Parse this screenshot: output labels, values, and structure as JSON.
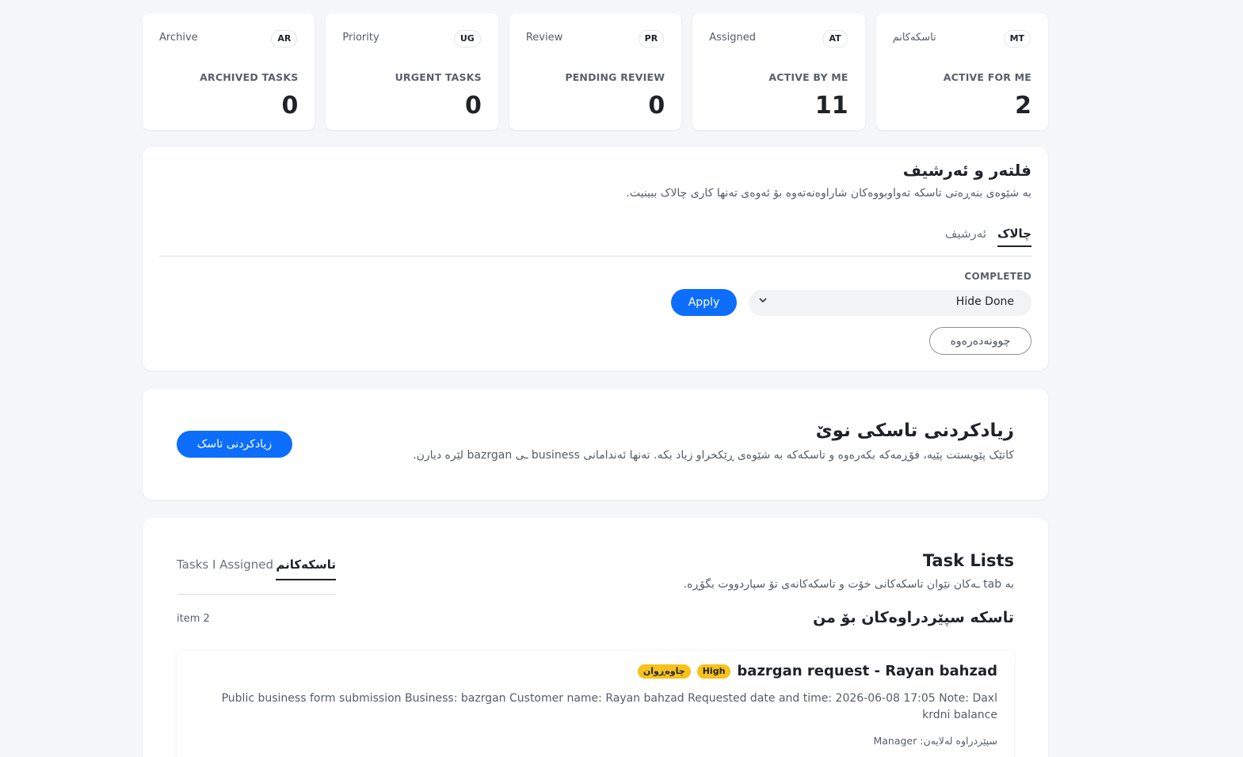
{
  "stats": [
    {
      "label": "Archive",
      "badge": "AR",
      "title": "ARCHIVED TASKS",
      "value": "0"
    },
    {
      "label": "Priority",
      "badge": "UG",
      "title": "URGENT TASKS",
      "value": "0"
    },
    {
      "label": "Review",
      "badge": "PR",
      "title": "PENDING REVIEW",
      "value": "0"
    },
    {
      "label": "Assigned",
      "badge": "AT",
      "title": "ACTIVE BY ME",
      "value": "11"
    },
    {
      "label": "تاسکەکانم",
      "badge": "MT",
      "title": "ACTIVE FOR ME",
      "value": "2"
    }
  ],
  "filter": {
    "title": "فلتەر و ئەرشیف",
    "description": "بە شێوەی بنەڕەتی تاسکە تەواوبووەکان شاراوەنەتەوە بۆ ئەوەی تەنها کاری چالاک ببینیت.",
    "tabs": [
      "چالاک",
      "ئەرشیف"
    ],
    "completed_label": "COMPLETED",
    "completed_value": "Hide Done",
    "apply_label": "Apply",
    "reset_label": "چوونەدەرەوە"
  },
  "new_task": {
    "title": "زیادکردنی تاسکی نوێ",
    "description": "کاتێک پێویستت پێیە، فۆڕمەکە بکەرەوە و تاسکەکە بە شێوەی ڕێکخراو زیاد بکە. تەنها ئەندامانی business ـی bazrgan لێرە دیارن.",
    "button_label": "زیادکردنی تاسک"
  },
  "task_lists": {
    "title": "Task Lists",
    "description": "بە tab ـەکان نێوان تاسکەکانی خۆت و تاسکەکانەی تۆ سپاردووت بگۆڕە.",
    "tabs": [
      "تاسکەکانم",
      "Tasks I Assigned"
    ],
    "section_title": "تاسکە سپێردراوەکان بۆ من",
    "count": "item 2",
    "tasks": [
      {
        "name": "bazrgan request - Rayan bahzad",
        "priority": "High",
        "status": "چاوەڕوان",
        "body": "Public business form submission Business: bazrgan Customer name: Rayan bahzad Requested date and time: 2026-06-08 17:05 Note: Daxl krdni balance",
        "assigned_by": "سپێردراوە لەلایەن: Manager"
      }
    ]
  }
}
